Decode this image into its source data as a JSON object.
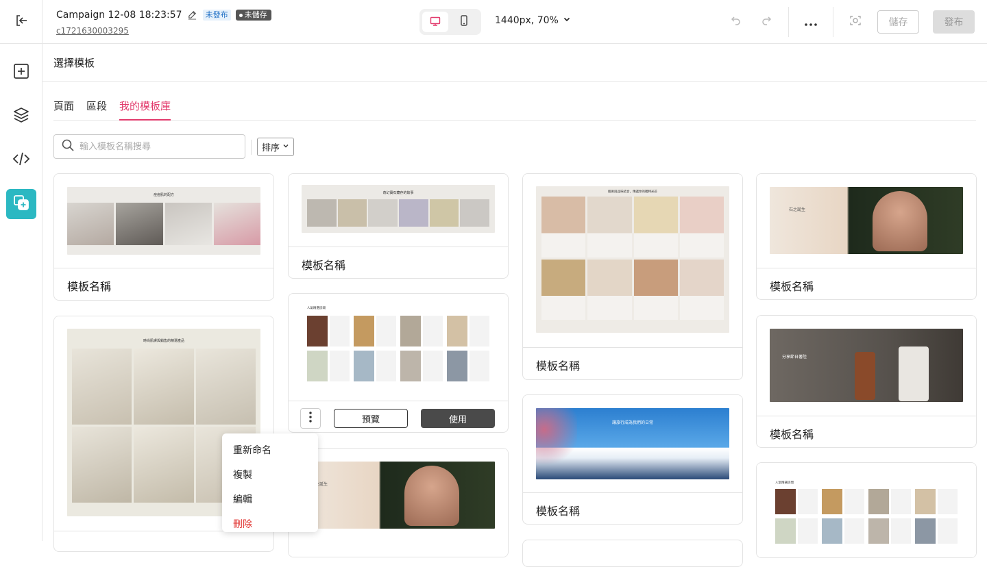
{
  "header": {
    "title": "Campaign 12-08 18:23:57",
    "status_unpublished": "未發布",
    "status_unsaved": "未儲存",
    "campaign_id": "c1721630003295",
    "zoom": "1440px, 70%",
    "save_label": "儲存",
    "publish_label": "發布"
  },
  "panel": {
    "title": "選擇模板",
    "tabs": [
      "頁面",
      "區段",
      "我的模板庫"
    ],
    "active_tab": "我的模板庫",
    "search_placeholder": "輸入模板名稱搜尋",
    "sort_label": "排序"
  },
  "cards": {
    "name": "模板名稱",
    "preview_label": "預覽",
    "use_label": "使用"
  },
  "thumbs": {
    "skincare_title": "痘痘肌的配方",
    "jewelry_strip_title": "奇幻寶石藏存的故事",
    "jewelry_grid_title": "藝術與品味結合，傳遞你的獨特光芒",
    "stone_title": "石之誕生",
    "hotel_title": "人氣精選房間",
    "serum_title": "時尚肌膚與銷售的精選產品",
    "fuji_title": "讓旅行成為我們的日常",
    "perfume_title": "分享節日著陸"
  },
  "context_menu": {
    "items": [
      "重新命名",
      "複製",
      "編輯",
      "刪除"
    ]
  },
  "colors": {
    "accent": "#e23a6c",
    "rail_active": "#2bb8c2",
    "danger": "#e0322f"
  }
}
